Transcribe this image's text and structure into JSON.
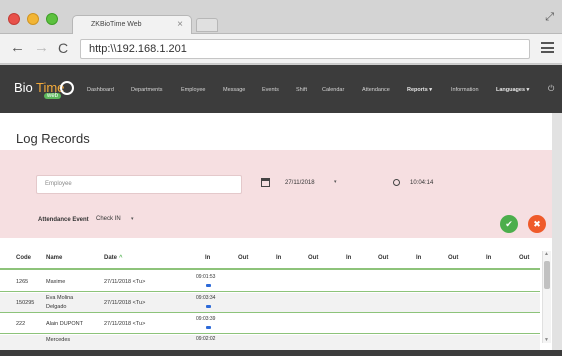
{
  "browser": {
    "tab_title": "ZKBioTime Web",
    "tab_close": "×",
    "url": "http:\\\\192.168.1.201",
    "back_glyph": "←",
    "forward_glyph": "→",
    "reload_glyph": "C",
    "fullscreen_glyph": "⤢"
  },
  "logo": {
    "bio": "Bio",
    "time": "Time",
    "web": "web"
  },
  "nav": {
    "items": [
      "Dashboard",
      "Departments",
      "Employee",
      "Message",
      "Events",
      "Shift",
      "Calendar",
      "Attendance",
      "Reports ▾",
      "Information",
      "Languages ▾"
    ],
    "power_glyph": "⏻"
  },
  "page": {
    "title": "Log Records"
  },
  "filter": {
    "employee_placeholder": "Employee",
    "date": "27/11/2018",
    "date_caret": "▾",
    "time": "10:04:14",
    "attendance_label": "Attendance Event",
    "attendance_value": "Check IN",
    "attendance_caret": "▾",
    "ok_glyph": "✔",
    "cancel_glyph": "✖"
  },
  "table": {
    "headers": [
      "Code",
      "Name",
      "Date",
      "In",
      "Out",
      "In",
      "Out",
      "In",
      "Out",
      "In",
      "Out",
      "In",
      "Out"
    ],
    "sort_glyph": "^",
    "rows": [
      {
        "code": "1265",
        "name": [
          "Maxime"
        ],
        "date": "27/11/2018 <Tu>",
        "punch": "09:01:53"
      },
      {
        "code": "150295",
        "name": [
          "Eva Molina",
          "Delgado"
        ],
        "date": "27/11/2018 <Tu>",
        "punch": "09:03:34"
      },
      {
        "code": "222",
        "name": [
          "Alain DUPONT"
        ],
        "date": "27/11/2018 <Tu>",
        "punch": "09:03:39"
      },
      {
        "code": "",
        "name": [
          "Mercedes"
        ],
        "date": "",
        "punch": "09:02:02"
      }
    ]
  },
  "scrollbar": {
    "up": "▲",
    "down": "▼"
  },
  "colors": {
    "nav_bg": "#3c3c3c",
    "filter_bg": "#f6dfe1",
    "accent_green": "#4cae4c",
    "accent_orange": "#ef5a2a",
    "row_rule": "#8dc37a",
    "punch_icon": "#2d6ad8"
  }
}
